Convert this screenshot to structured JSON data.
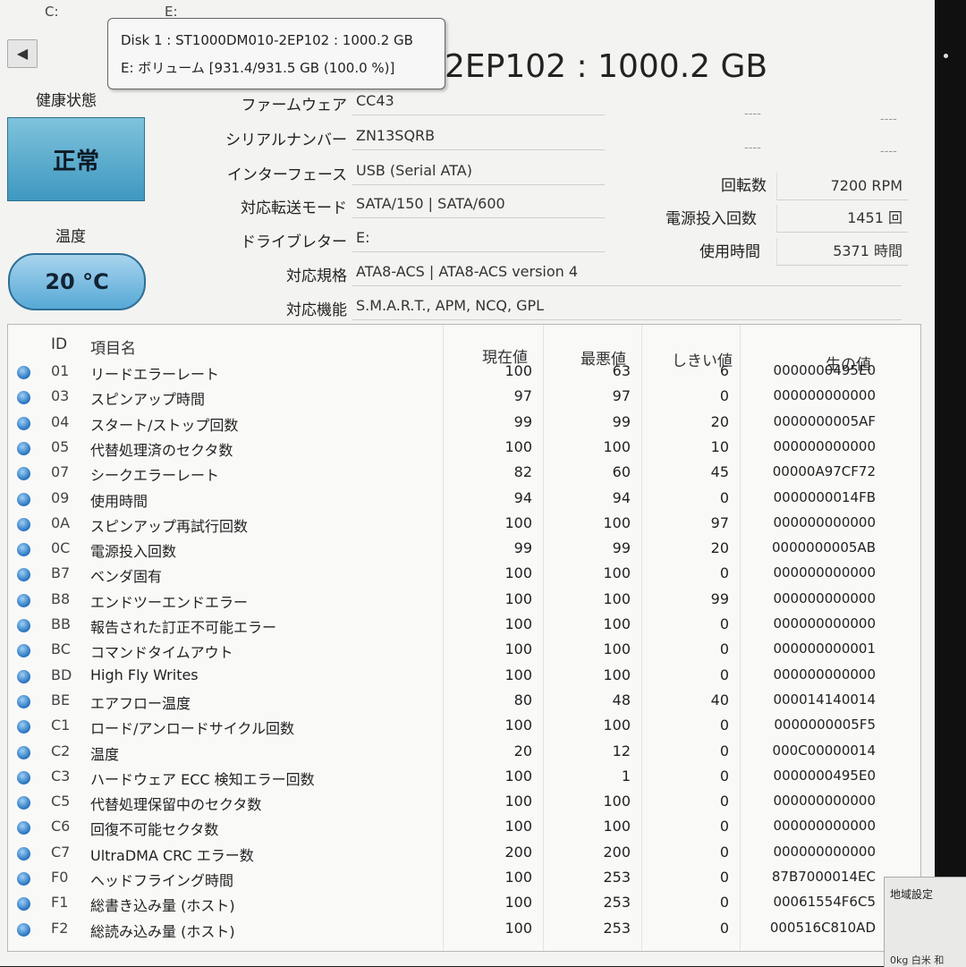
{
  "drive_tabs": [
    "C:",
    "E:"
  ],
  "tooltip": {
    "line1": "Disk 1 : ST1000DM010-2EP102 : 1000.2 GB",
    "line2": "E: ボリューム [931.4/931.5 GB (100.0 %)]"
  },
  "disk_title": "2EP102 : 1000.2 GB",
  "health": {
    "label": "健康状態",
    "value": "正常"
  },
  "temperature": {
    "label": "温度",
    "value": "20 °C"
  },
  "info": {
    "firmware": {
      "label": "ファームウェア",
      "value": "CC43"
    },
    "serial": {
      "label": "シリアルナンバー",
      "value": "ZN13SQRB"
    },
    "interface": {
      "label": "インターフェース",
      "value": "USB (Serial ATA)"
    },
    "transfer": {
      "label": "対応転送モード",
      "value": "SATA/150 | SATA/600"
    },
    "drive_letter": {
      "label": "ドライブレター",
      "value": "E:"
    },
    "standard": {
      "label": "対応規格",
      "value": "ATA8-ACS | ATA8-ACS version 4"
    },
    "features": {
      "label": "対応機能",
      "value": "S.M.A.R.T., APM, NCQ, GPL"
    }
  },
  "right_info": {
    "dash": "----",
    "rotation": {
      "label": "回転数",
      "value": "7200 RPM"
    },
    "power_count": {
      "label": "電源投入回数",
      "value": "1451 回"
    },
    "power_hours": {
      "label": "使用時間",
      "value": "5371 時間"
    }
  },
  "smart_headers": {
    "id": "ID",
    "name": "項目名",
    "current": "現在値",
    "worst": "最悪値",
    "threshold": "しきい値",
    "raw": "生の値"
  },
  "smart_rows": [
    {
      "id": "01",
      "name": "リードエラーレート",
      "current": "100",
      "worst": "63",
      "threshold": "6",
      "raw": "0000000495E0"
    },
    {
      "id": "03",
      "name": "スピンアップ時間",
      "current": "97",
      "worst": "97",
      "threshold": "0",
      "raw": "000000000000"
    },
    {
      "id": "04",
      "name": "スタート/ストップ回数",
      "current": "99",
      "worst": "99",
      "threshold": "20",
      "raw": "0000000005AF"
    },
    {
      "id": "05",
      "name": "代替処理済のセクタ数",
      "current": "100",
      "worst": "100",
      "threshold": "10",
      "raw": "000000000000"
    },
    {
      "id": "07",
      "name": "シークエラーレート",
      "current": "82",
      "worst": "60",
      "threshold": "45",
      "raw": "00000A97CF72"
    },
    {
      "id": "09",
      "name": "使用時間",
      "current": "94",
      "worst": "94",
      "threshold": "0",
      "raw": "0000000014FB"
    },
    {
      "id": "0A",
      "name": "スピンアップ再試行回数",
      "current": "100",
      "worst": "100",
      "threshold": "97",
      "raw": "000000000000"
    },
    {
      "id": "0C",
      "name": "電源投入回数",
      "current": "99",
      "worst": "99",
      "threshold": "20",
      "raw": "0000000005AB"
    },
    {
      "id": "B7",
      "name": "ベンダ固有",
      "current": "100",
      "worst": "100",
      "threshold": "0",
      "raw": "000000000000"
    },
    {
      "id": "B8",
      "name": "エンドツーエンドエラー",
      "current": "100",
      "worst": "100",
      "threshold": "99",
      "raw": "000000000000"
    },
    {
      "id": "BB",
      "name": "報告された訂正不可能エラー",
      "current": "100",
      "worst": "100",
      "threshold": "0",
      "raw": "000000000000"
    },
    {
      "id": "BC",
      "name": "コマンドタイムアウト",
      "current": "100",
      "worst": "100",
      "threshold": "0",
      "raw": "000000000001"
    },
    {
      "id": "BD",
      "name": "High Fly Writes",
      "current": "100",
      "worst": "100",
      "threshold": "0",
      "raw": "000000000000"
    },
    {
      "id": "BE",
      "name": "エアフロー温度",
      "current": "80",
      "worst": "48",
      "threshold": "40",
      "raw": "000014140014"
    },
    {
      "id": "C1",
      "name": "ロード/アンロードサイクル回数",
      "current": "100",
      "worst": "100",
      "threshold": "0",
      "raw": "0000000005F5"
    },
    {
      "id": "C2",
      "name": "温度",
      "current": "20",
      "worst": "12",
      "threshold": "0",
      "raw": "000C00000014"
    },
    {
      "id": "C3",
      "name": "ハードウェア ECC 検知エラー回数",
      "current": "100",
      "worst": "1",
      "threshold": "0",
      "raw": "0000000495E0"
    },
    {
      "id": "C5",
      "name": "代替処理保留中のセクタ数",
      "current": "100",
      "worst": "100",
      "threshold": "0",
      "raw": "000000000000"
    },
    {
      "id": "C6",
      "name": "回復不可能セクタ数",
      "current": "100",
      "worst": "100",
      "threshold": "0",
      "raw": "000000000000"
    },
    {
      "id": "C7",
      "name": "UltraDMA CRC エラー数",
      "current": "200",
      "worst": "200",
      "threshold": "0",
      "raw": "000000000000"
    },
    {
      "id": "F0",
      "name": "ヘッドフライング時間",
      "current": "100",
      "worst": "253",
      "threshold": "0",
      "raw": "87B7000014EC"
    },
    {
      "id": "F1",
      "name": "総書き込み量 (ホスト)",
      "current": "100",
      "worst": "253",
      "threshold": "0",
      "raw": "00061554F6C5"
    },
    {
      "id": "F2",
      "name": "総読み込み量 (ホスト)",
      "current": "100",
      "worst": "253",
      "threshold": "0",
      "raw": "000516C810AD"
    }
  ],
  "taskbar": {
    "region": "地域設定",
    "misc": "0kg 白米 和"
  }
}
